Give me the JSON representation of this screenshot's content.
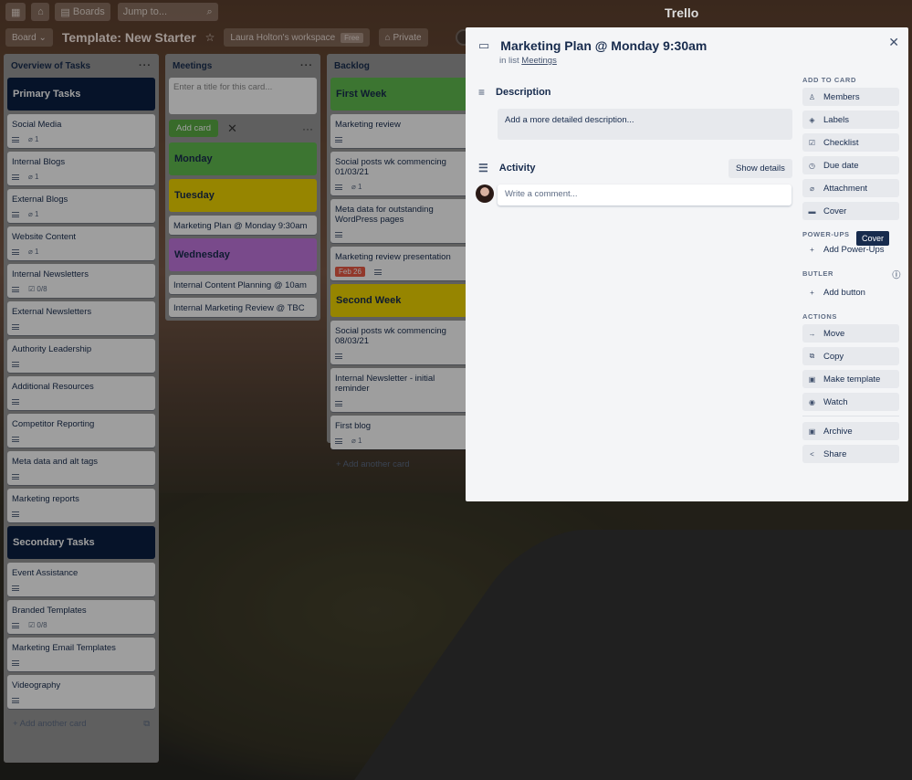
{
  "header": {
    "boards_label": "Boards",
    "search_placeholder": "Jump to...",
    "logo": "Trello"
  },
  "boardbar": {
    "board_btn": "Board",
    "title": "Template: New Starter",
    "workspace": "Laura Holton's workspace",
    "plan": "Free",
    "visibility": "Private"
  },
  "lists": {
    "overview": {
      "title": "Overview of Tasks",
      "menu": "···",
      "primary": "Primary Tasks",
      "secondary": "Secondary Tasks",
      "add_another": "Add another card",
      "cards": [
        {
          "title": "Social Media",
          "attach": "1"
        },
        {
          "title": "Internal Blogs",
          "attach": "1"
        },
        {
          "title": "External Blogs",
          "attach": "1"
        },
        {
          "title": "Website Content",
          "attach": "1"
        },
        {
          "title": "Internal Newsletters",
          "check": "0/8"
        },
        {
          "title": "External Newsletters"
        },
        {
          "title": "Authority Leadership"
        },
        {
          "title": "Additional Resources"
        },
        {
          "title": "Competitor Reporting"
        },
        {
          "title": "Meta data and alt tags"
        },
        {
          "title": "Marketing reports"
        }
      ],
      "cards2": [
        {
          "title": "Event Assistance"
        },
        {
          "title": "Branded Templates",
          "check": "0/8"
        },
        {
          "title": "Marketing Email Templates"
        },
        {
          "title": "Videography"
        }
      ]
    },
    "meetings": {
      "title": "Meetings",
      "menu": "···",
      "composer_placeholder": "Enter a title for this card...",
      "add_btn": "Add card",
      "monday": "Monday",
      "tuesday": "Tuesday",
      "wednesday": "Wednesday",
      "c1": "Marketing Plan @ Monday 9:30am",
      "c2": "Internal Content Planning @ 10am",
      "c3": "Internal Marketing Review @ TBC"
    },
    "backlog": {
      "title": "Backlog",
      "first_week": "First Week",
      "second_week": "Second Week",
      "add_another": "Add another card",
      "cards": [
        {
          "title": "Marketing review"
        },
        {
          "title": "Social posts wk commencing 01/03/21",
          "attach": "1"
        },
        {
          "title": "Meta data for outstanding WordPress pages"
        },
        {
          "title": "Marketing review presentation",
          "due": "Feb 26"
        }
      ],
      "cards2": [
        {
          "title": "Social posts wk commencing 08/03/21"
        },
        {
          "title": "Internal Newsletter - initial reminder"
        },
        {
          "title": "First blog",
          "attach": "1"
        }
      ]
    }
  },
  "modal": {
    "title": "Marketing Plan @ Monday 9:30am",
    "in_list_prefix": "in list",
    "list_name": "Meetings",
    "description_h": "Description",
    "description_placeholder": "Add a more detailed description...",
    "activity_h": "Activity",
    "show_details": "Show details",
    "comment_placeholder": "Write a comment...",
    "add_to_card_h": "ADD TO CARD",
    "add_to_card": [
      "Members",
      "Labels",
      "Checklist",
      "Due date",
      "Attachment",
      "Cover"
    ],
    "powerups_h": "POWER-UPS",
    "add_powerups": "Add Power-Ups",
    "butler_h": "BUTLER",
    "add_button": "Add button",
    "actions_h": "ACTIONS",
    "actions": [
      "Move",
      "Copy",
      "Make template",
      "Watch"
    ],
    "archive": "Archive",
    "share": "Share",
    "tooltip": "Cover"
  }
}
